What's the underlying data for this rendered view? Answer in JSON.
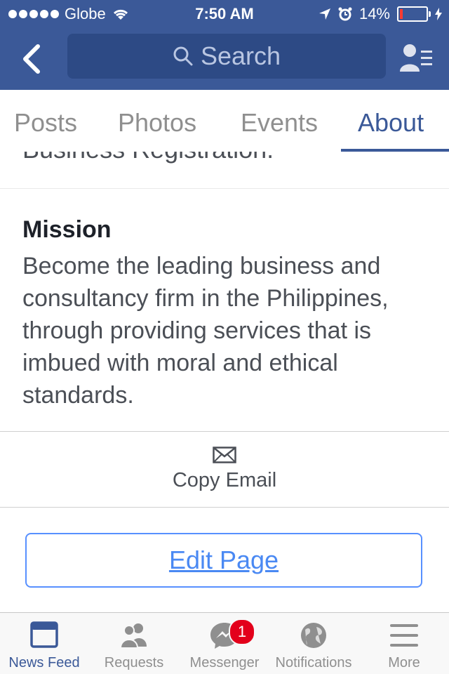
{
  "status_bar": {
    "carrier": "Globe",
    "time": "7:50 AM",
    "battery": "14%",
    "battery_level": 0.14
  },
  "nav": {
    "search_placeholder": "Search"
  },
  "tabs": [
    {
      "label": "Posts",
      "active": false
    },
    {
      "label": "Photos",
      "active": false
    },
    {
      "label": "Events",
      "active": false
    },
    {
      "label": "About",
      "active": true
    }
  ],
  "content": {
    "cut_off_text": "Business Registration.",
    "mission_title": "Mission",
    "mission_body": "Become the leading business and consultancy firm in the Philippines, through providing services that is imbued with moral and ethical standards.",
    "copy_email_label": "Copy Email",
    "edit_page_label": "Edit Page"
  },
  "tabbar": {
    "items": [
      {
        "label": "News Feed",
        "icon": "news-feed-icon",
        "active": true
      },
      {
        "label": "Requests",
        "icon": "friends-icon",
        "active": false
      },
      {
        "label": "Messenger",
        "icon": "messenger-icon",
        "active": false,
        "badge": "1"
      },
      {
        "label": "Notifications",
        "icon": "globe-icon",
        "active": false
      },
      {
        "label": "More",
        "icon": "hamburger-icon",
        "active": false
      }
    ]
  },
  "colors": {
    "brand_blue": "#3b5998",
    "link_blue": "#4a89f3",
    "badge_red": "#e3001b"
  }
}
